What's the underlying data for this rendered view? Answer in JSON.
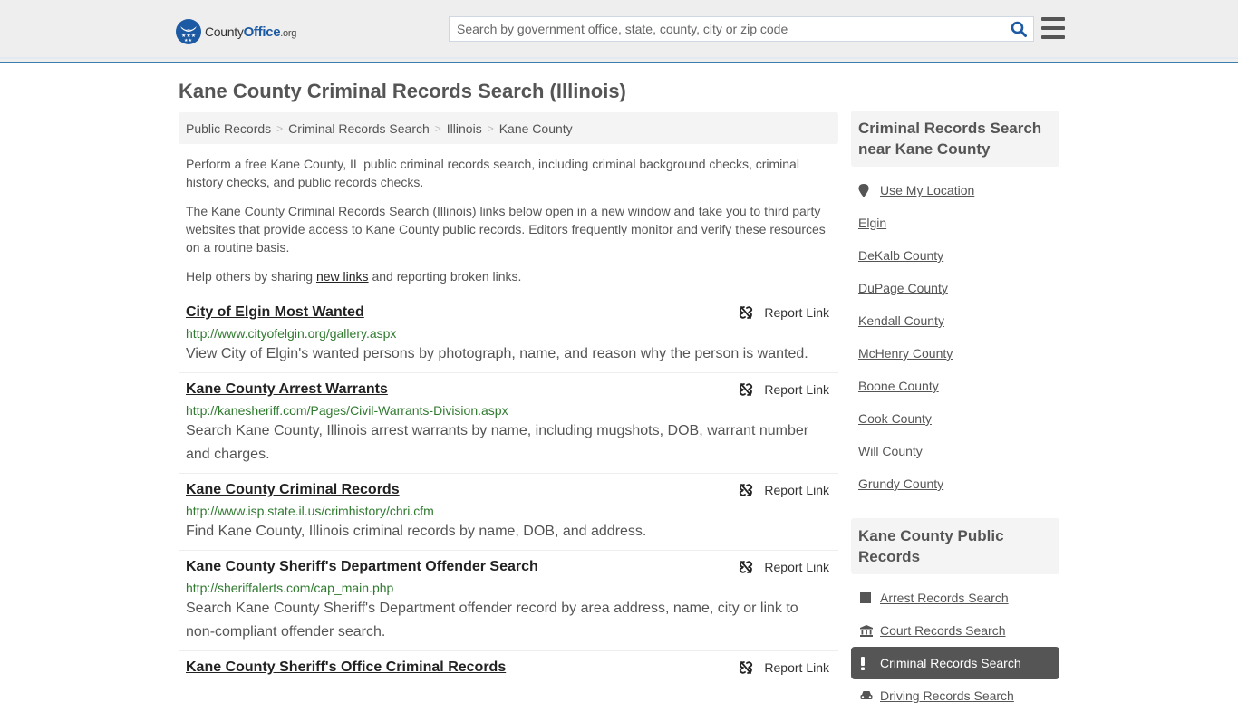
{
  "header": {
    "logo_text_prefix": "County",
    "logo_text_bold": "Office",
    "logo_text_suffix": ".org",
    "search_placeholder": "Search by government office, state, county, city or zip code",
    "search_icon": "search-icon",
    "menu_icon": "hamburger-menu-icon"
  },
  "page": {
    "title": "Kane County Criminal Records Search (Illinois)"
  },
  "breadcrumb": [
    {
      "label": "Public Records"
    },
    {
      "label": "Criminal Records Search"
    },
    {
      "label": "Illinois"
    },
    {
      "label": "Kane County"
    }
  ],
  "breadcrumb_separator": ">",
  "intro": {
    "p1": "Perform a free Kane County, IL public criminal records search, including criminal background checks, criminal history checks, and public records checks.",
    "p2": "The Kane County Criminal Records Search (Illinois) links below open in a new window and take you to third party websites that provide access to Kane County public records. Editors frequently monitor and verify these resources on a routine basis.",
    "p3_before": "Help others by sharing ",
    "p3_link": "new links",
    "p3_after": " and reporting broken links."
  },
  "report_label": "Report Link",
  "listings": [
    {
      "title": "City of Elgin Most Wanted",
      "url": "http://www.cityofelgin.org/gallery.aspx",
      "description": "View City of Elgin's wanted persons by photograph, name, and reason why the person is wanted."
    },
    {
      "title": "Kane County Arrest Warrants",
      "url": "http://kanesheriff.com/Pages/Civil-Warrants-Division.aspx",
      "description": "Search Kane County, Illinois arrest warrants by name, including mugshots, DOB, warrant number and charges."
    },
    {
      "title": "Kane County Criminal Records",
      "url": "http://www.isp.state.il.us/crimhistory/chri.cfm",
      "description": "Find Kane County, Illinois criminal records by name, DOB, and address."
    },
    {
      "title": "Kane County Sheriff's Department Offender Search",
      "url": "http://sheriffalerts.com/cap_main.php",
      "description": "Search Kane County Sheriff's Department offender record by area address, name, city or link to non-compliant offender search."
    },
    {
      "title": "Kane County Sheriff's Office Criminal Records",
      "url": "",
      "description": ""
    }
  ],
  "sidebar": {
    "nearby_heading": "Criminal Records Search near Kane County",
    "use_location_label": "Use My Location",
    "nearby": [
      {
        "label": "Elgin"
      },
      {
        "label": "DeKalb County"
      },
      {
        "label": "DuPage County"
      },
      {
        "label": "Kendall County"
      },
      {
        "label": "McHenry County"
      },
      {
        "label": "Boone County"
      },
      {
        "label": "Cook County"
      },
      {
        "label": "Will County"
      },
      {
        "label": "Grundy County"
      }
    ],
    "public_records_heading": "Kane County Public Records",
    "public_records": [
      {
        "label": "Arrest Records Search",
        "icon": "square-icon",
        "active": false
      },
      {
        "label": "Court Records Search",
        "icon": "courthouse-icon",
        "active": false
      },
      {
        "label": "Criminal Records Search",
        "icon": "exclamation-icon",
        "active": true
      },
      {
        "label": "Driving Records Search",
        "icon": "car-icon",
        "active": false
      }
    ]
  },
  "colors": {
    "brand_blue": "#1c5aa3",
    "header_border": "#3a7eae",
    "url_green": "#2f7a2f",
    "active_item_bg": "#555555"
  }
}
